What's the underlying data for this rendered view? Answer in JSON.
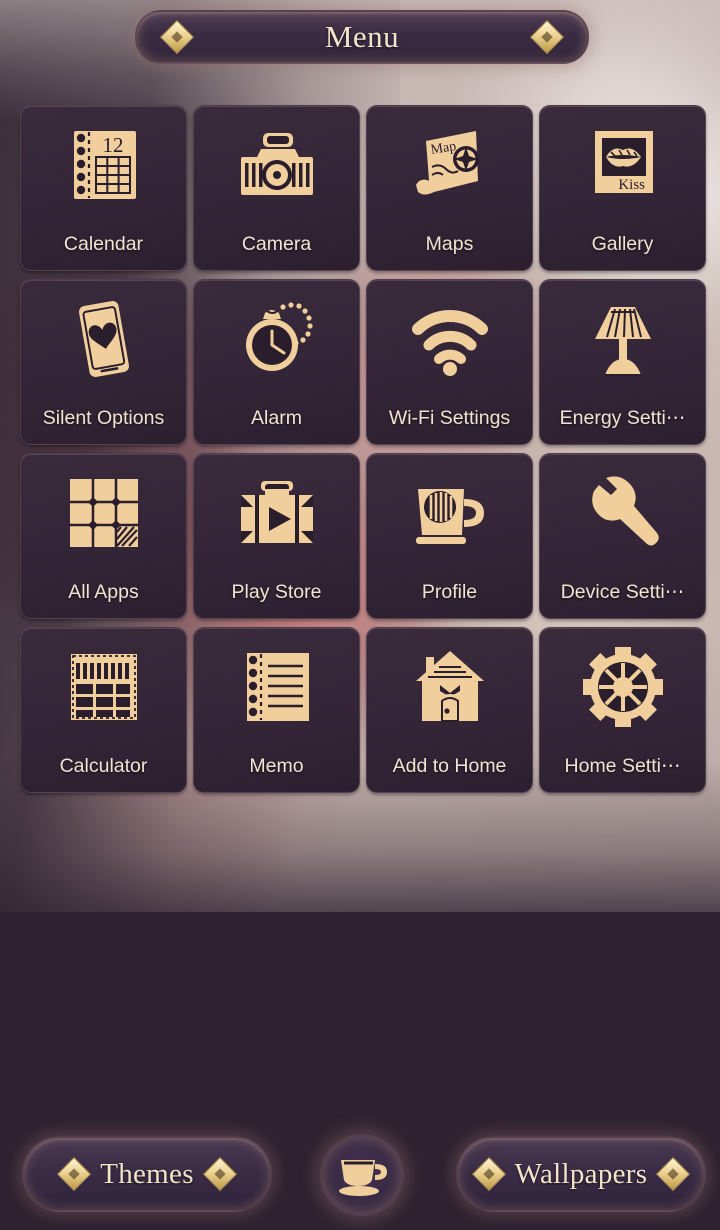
{
  "header": {
    "title": "Menu",
    "ornament_left": "diamond-ornament",
    "ornament_right": "diamond-ornament"
  },
  "theme": {
    "tile_background": "#342638",
    "label_color": "#f2e4d0",
    "icon_color": "#f0cf9d",
    "page_background": "#2e2230",
    "accent_gold": "#ecd391"
  },
  "grid": {
    "columns": 4,
    "rows": 4,
    "items": [
      {
        "label": "Calendar",
        "icon": "calendar-icon",
        "badge": "12"
      },
      {
        "label": "Camera",
        "icon": "camera-icon"
      },
      {
        "label": "Maps",
        "icon": "map-scroll-icon",
        "badge": "Map"
      },
      {
        "label": "Gallery",
        "icon": "gallery-photo-icon",
        "badge": "Kiss"
      },
      {
        "label": "Silent Options",
        "icon": "phone-heart-icon"
      },
      {
        "label": "Alarm",
        "icon": "pocket-watch-icon"
      },
      {
        "label": "Wi-Fi Settings",
        "icon": "wifi-icon"
      },
      {
        "label": "Energy Setti⋯",
        "icon": "table-lamp-icon"
      },
      {
        "label": "All Apps",
        "icon": "app-grid-icon"
      },
      {
        "label": "Play Store",
        "icon": "suitcase-play-icon"
      },
      {
        "label": "Profile",
        "icon": "coffee-mug-icon"
      },
      {
        "label": "Device Setti⋯",
        "icon": "wrench-icon"
      },
      {
        "label": "Calculator",
        "icon": "calculator-icon"
      },
      {
        "label": "Memo",
        "icon": "notepad-icon"
      },
      {
        "label": "Add to Home",
        "icon": "house-icon"
      },
      {
        "label": "Home Setti⋯",
        "icon": "gear-icon"
      }
    ]
  },
  "dock": {
    "themes_label": "Themes",
    "wallpapers_label": "Wallpapers",
    "center_icon": "teacup-icon"
  }
}
